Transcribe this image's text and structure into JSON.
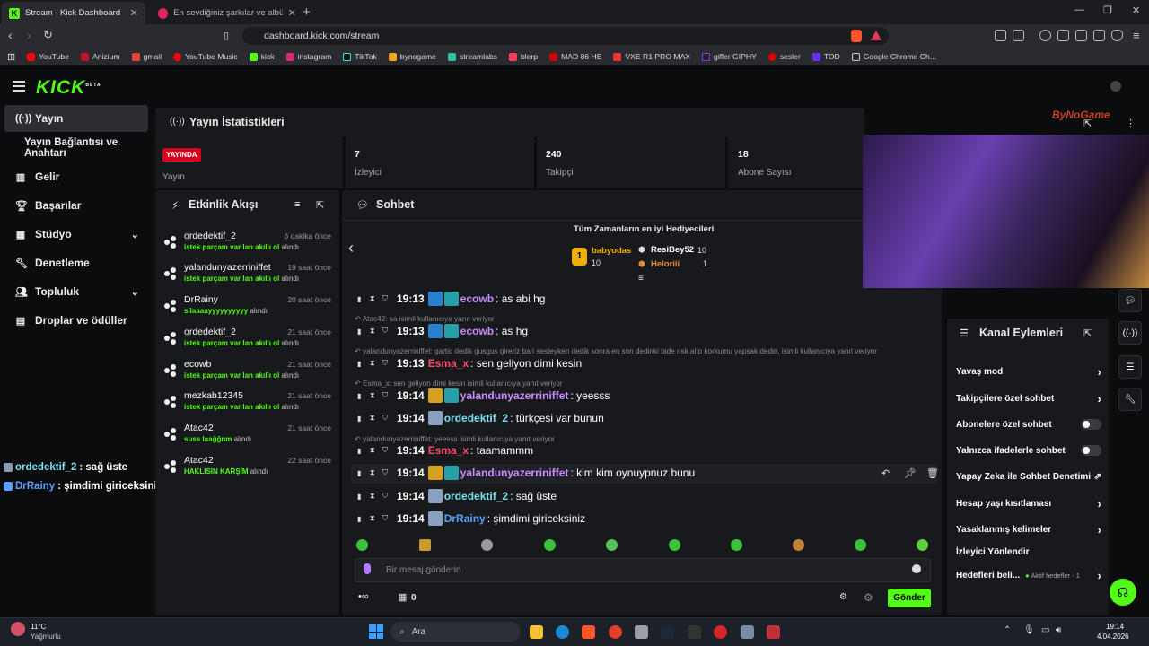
{
  "browser": {
    "tabs": [
      {
        "label": "Stream - Kick Dashboard",
        "active": true
      },
      {
        "label": "En sevdiğiniz şarkılar ve albümleri din",
        "active": false
      }
    ],
    "url": "dashboard.kick.com/stream",
    "bookmarks": [
      "YouTube",
      "Anizium",
      "gmail",
      "YouTube Music",
      "kick",
      "instagram",
      "TikTok",
      "bynogame",
      "streamlabs",
      "blerp",
      "MAD 86 HE",
      "VXE R1 PRO MAX",
      "gifler GIPHY",
      "sesler",
      "TOD",
      "Google Chrome Ch..."
    ]
  },
  "brand": {
    "logo": "KICK",
    "beta": "BETA",
    "accent": "#53fc18"
  },
  "sidebar": {
    "items": [
      {
        "label": "Yayın",
        "icon": "broadcast-icon"
      },
      {
        "label": "Yayın Bağlantısı ve Anahtarı",
        "icon": ""
      },
      {
        "label": "Gelir",
        "icon": "chart-icon"
      },
      {
        "label": "Başarılar",
        "icon": "trophy-icon"
      },
      {
        "label": "Stüdyo",
        "icon": "grid-icon"
      },
      {
        "label": "Denetleme",
        "icon": "wrench-icon"
      },
      {
        "label": "Topluluk",
        "icon": "people-icon"
      },
      {
        "label": "Droplar ve ödüller",
        "icon": "gift-icon"
      }
    ],
    "overlay_chat": [
      {
        "user": "ordedektif_2",
        "text": " : sağ üste"
      },
      {
        "user": "DrRainy",
        "text": " : şimdimi giriceksiniz"
      }
    ]
  },
  "stats": {
    "title": "Yayın İstatistikleri",
    "live_badge": "YAYINDA",
    "live_label": "Yayın",
    "viewers": "7",
    "viewers_label": "İzleyici",
    "followers": "240",
    "followers_label": "Takipçi",
    "subs": "18",
    "subs_label": "Abone Sayısı"
  },
  "activity": {
    "title": "Etkinlik Akışı",
    "items": [
      {
        "user": "ordedektif_2",
        "time": "6 dakika önce",
        "event": "istek parçam var lan akıllı ol",
        "suffix": " alındı"
      },
      {
        "user": "yalandunyazerriniffet",
        "time": "19 saat önce",
        "event": "istek parçam var lan akıllı ol",
        "suffix": " alındı"
      },
      {
        "user": "DrRainy",
        "time": "20 saat önce",
        "event": "silaaaayyyyyyyyyy",
        "suffix": " alındı"
      },
      {
        "user": "ordedektif_2",
        "time": "21 saat önce",
        "event": "istek parçam var lan akıllı ol",
        "suffix": " alındı"
      },
      {
        "user": "ecowb",
        "time": "21 saat önce",
        "event": "istek parçam var lan akıllı ol",
        "suffix": " alındı"
      },
      {
        "user": "mezkab12345",
        "time": "21 saat önce",
        "event": "istek parçam var lan akıllı ol",
        "suffix": " alındı"
      },
      {
        "user": "Atac42",
        "time": "21 saat önce",
        "event": "suss laağğnm",
        "suffix": " alındı"
      },
      {
        "user": "Atac42",
        "time": "22 saat önce",
        "event": "HAKLISIN KARŞİM",
        "suffix": " alındı"
      }
    ]
  },
  "chat": {
    "title": "Sohbet",
    "gifters_title": "Tüm Zamanların en iyi Hediyecileri",
    "gifters": [
      {
        "name": "babyodas",
        "count": "10"
      },
      {
        "name": "ResiBey52",
        "count": "10"
      },
      {
        "name": "Heloriii",
        "count": "1"
      }
    ],
    "messages": [
      {
        "context": "",
        "time": "19:13",
        "user": "ecowb",
        "color": "#c88cff",
        "text": ": as abi hg"
      },
      {
        "context": "Atac42: sa isimli kullanıcıya yanıt veriyor",
        "time": "19:13",
        "user": "ecowb",
        "color": "#c88cff",
        "text": ": as hg"
      },
      {
        "context": "yalandunyazerriniffet: gartic dedik gusgus gireriz bari sesteyken dedik sonra en son dedinki bide risk alıp korkumu yapsak dedin, isimli kullanıcıya yanıt veriyor",
        "time": "19:13",
        "user": "Esma_x",
        "color": "#ff4a6a",
        "text": ": sen geliyon dimi kesin"
      },
      {
        "context": "Esma_x: sen geliyon dimi kesin isimli kullanıcıya yanıt veriyor",
        "time": "19:14",
        "user": "yalandunyazerriniffet",
        "color": "#c88cff",
        "text": ": yeesss"
      },
      {
        "context": "",
        "time": "19:14",
        "user": "ordedektif_2",
        "color": "#7fe0f0",
        "text": ": türkçesi var bunun"
      },
      {
        "context": "yalandunyazerriniffet: yeesss isimli kullanıcıya yanıt veriyor",
        "time": "19:14",
        "user": "Esma_x",
        "color": "#ff4a6a",
        "text": ": taamammm"
      },
      {
        "context": "",
        "time": "19:14",
        "user": "yalandunyazerriniffet",
        "color": "#c88cff",
        "text": ": kim kim oynuypnuz bunu"
      },
      {
        "context": "",
        "time": "19:14",
        "user": "ordedektif_2",
        "color": "#7fe0f0",
        "text": ": sağ üste"
      },
      {
        "context": "",
        "time": "19:14",
        "user": "DrRainy",
        "color": "#5aa0ff",
        "text": ": şimdimi giriceksiniz"
      }
    ],
    "input_placeholder": "Bir mesaj gönderin",
    "bottom_count": "0",
    "send_label": "Gönder"
  },
  "channel_actions": {
    "title": "Kanal Eylemleri",
    "items": [
      {
        "label": "Yavaş mod",
        "control": "arrow"
      },
      {
        "label": "Takipçilere özel sohbet",
        "control": "arrow"
      },
      {
        "label": "Abonelere özel sohbet",
        "control": "toggle"
      },
      {
        "label": "Yalnızca ifadelerle sohbet",
        "control": "toggle"
      },
      {
        "label": "Yapay Zeka ile Sohbet Denetimi",
        "control": "external"
      },
      {
        "label": "Hesap yaşı kısıtlaması",
        "control": "arrow"
      },
      {
        "label": "Yasaklanmış kelimeler",
        "control": "arrow"
      },
      {
        "label": "İzleyici Yönlendir",
        "control": ""
      },
      {
        "label": "Hedefleri beli...",
        "control": "arrow"
      }
    ],
    "goal_status": "Aktif hedefler - 1"
  },
  "overlay": {
    "watermark": "ByNoGame"
  },
  "taskbar": {
    "weather_temp": "11°C",
    "weather_desc": "Yağmurlu",
    "search": "Ara",
    "time": "19:14",
    "date": "4.04.2026"
  }
}
